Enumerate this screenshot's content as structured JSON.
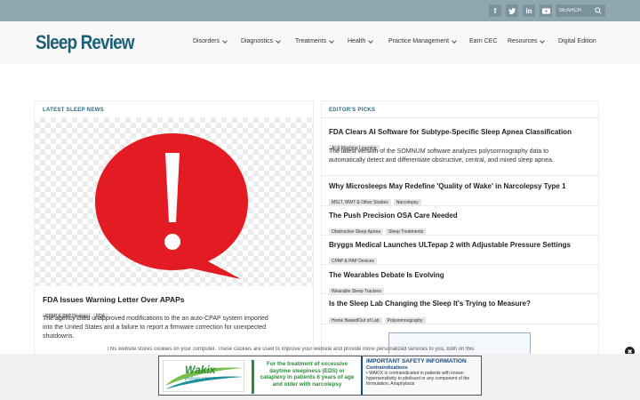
{
  "topbar": {
    "social": [
      "f",
      "t",
      "in",
      "yt"
    ],
    "search_placeholder": "SEARCH"
  },
  "header": {
    "logo": "Sleep Review",
    "nav": [
      {
        "label": "Disorders",
        "dropdown": true
      },
      {
        "label": "Diagnostics",
        "dropdown": true
      },
      {
        "label": "Treatments",
        "dropdown": true
      },
      {
        "label": "Health",
        "dropdown": true
      },
      {
        "label": "Practice Management",
        "dropdown": true
      },
      {
        "label": "Earn CEC",
        "dropdown": false
      },
      {
        "label": "Resources",
        "dropdown": true
      },
      {
        "label": "Digital Edition",
        "dropdown": false
      }
    ]
  },
  "latest": {
    "label": "LATEST SLEEP NEWS",
    "title": "FDA Issues Warning Letter Over APAPs",
    "tags": [
      "CPAP & PAP Devices",
      "FDA"
    ],
    "excerpt_line1": "The agency cited unapproved modifications to the an auto-CPAP system imported",
    "excerpt_line2": "into the United States and a failure to report a firmware correction for unexpected",
    "excerpt_line3": "shutdowns."
  },
  "picks": {
    "label": "EDITOR'S PICKS",
    "lead": {
      "title": "FDA Clears AI Software for Subtype-Specific Sleep Apnea Classification",
      "tag": "AI & Machine Learning",
      "excerpt_line1": "The latest version of the SOMNUM software analyzes polysomnography data to",
      "excerpt_line2": "automatically detect and differentiate obstructive, central, and mixed sleep apnea."
    },
    "items": [
      {
        "title": "Why Microsleeps May Redefine 'Quality of Wake' in Narcolepsy Type 1",
        "tags": [
          "MSLT, MWT & Other Studies",
          "Narcolepsy"
        ]
      },
      {
        "title": "The Push Precision OSA Care Needed",
        "tags": [
          "Obstructive Sleep Apnea",
          "Sleep Treatments"
        ]
      },
      {
        "title": "Bryggs Medical Launches ULTepap 2 with Adjustable Pressure Settings",
        "tags": [
          "CPAP & PAP Devices"
        ]
      },
      {
        "title": "The Wearables Debate Is Evolving",
        "tags": [
          "Wearable Sleep Trackers"
        ]
      },
      {
        "title": "Is the Sleep Lab Changing the Sleep It's Trying to Measure?",
        "tags": [
          "Home Based/Out of Lab",
          "Polysomnography"
        ]
      }
    ]
  },
  "cookie": {
    "text": "This website stores cookies on your computer. These cookies are used to improve your website and provide more personalized services to you, both on this",
    "close": "✖"
  },
  "ad": {
    "brand": "Wakix",
    "brand_sub": "pitolisant tablets",
    "mid": "For the treatment of excessive daytime sleepiness (EDS) or cataplexy in patients 6 years of age and older with narcolepsy",
    "safety_title": "IMPORTANT SAFETY INFORMATION",
    "contra_title": "Contraindications",
    "contra_text": "• WAKIX is contraindicated in patients with known hypersensitivity to pitolisant or any component of the formulation. Anaphylaxis"
  },
  "colors": {
    "topbar": "#8fa8b0",
    "logo": "#1c5f78",
    "section_label": "#2a6b83",
    "alert_red": "#e31b23",
    "ad_green": "#2e8b3a",
    "ad_navy": "#1a4a7a"
  }
}
